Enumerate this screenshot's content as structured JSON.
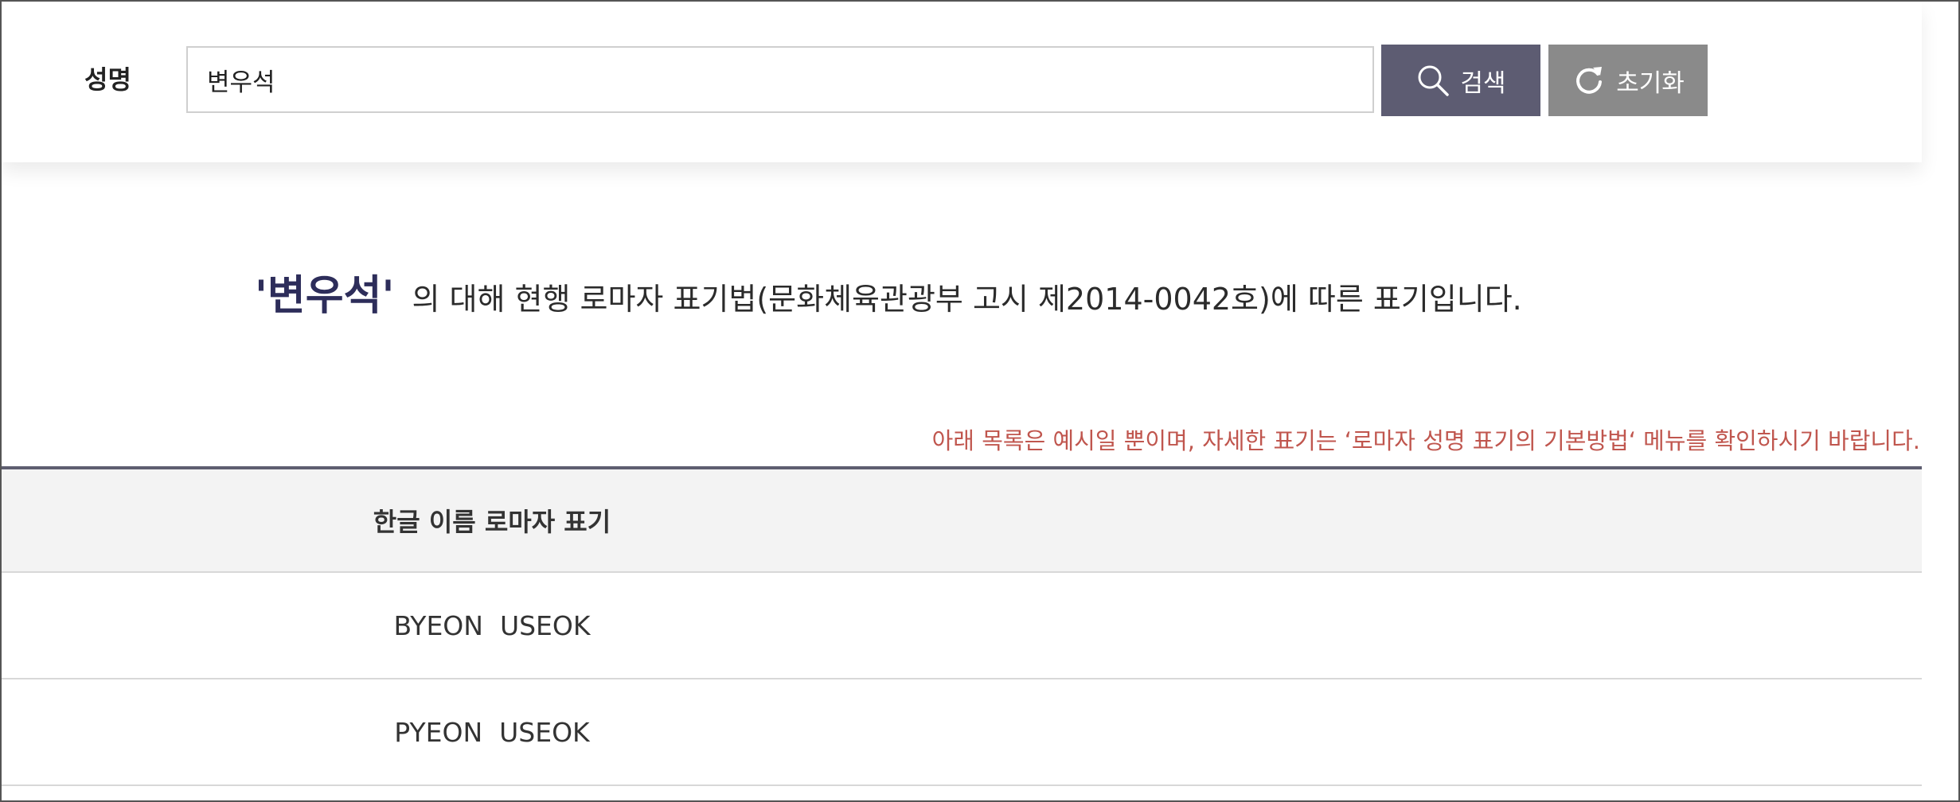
{
  "search": {
    "label": "성명",
    "value": "변우석",
    "search_label": "검색",
    "search_icon": "search-icon",
    "reset_label": "초기화",
    "reset_icon": "refresh-icon"
  },
  "headline": {
    "query": "'변우석'",
    "text": "의 대해 현행 로마자 표기법(문화체육관광부 고시 제2014-0042호)에 따른 표기입니다."
  },
  "notice": "아래 목록은 예시일 뿐이며, 자세한 표기는 ‘로마자 성명 표기의 기본방법‘ 메뉴를 확인하시기 바랍니다.",
  "table": {
    "header": "한글 이름 로마자 표기",
    "rows": [
      "BYEON  USEOK",
      "PYEON  USEOK"
    ]
  },
  "colors": {
    "search_button": "#5d5c72",
    "reset_button": "#8a8a8a",
    "query_highlight": "#2d2d5a",
    "notice_text": "#c0564e"
  }
}
